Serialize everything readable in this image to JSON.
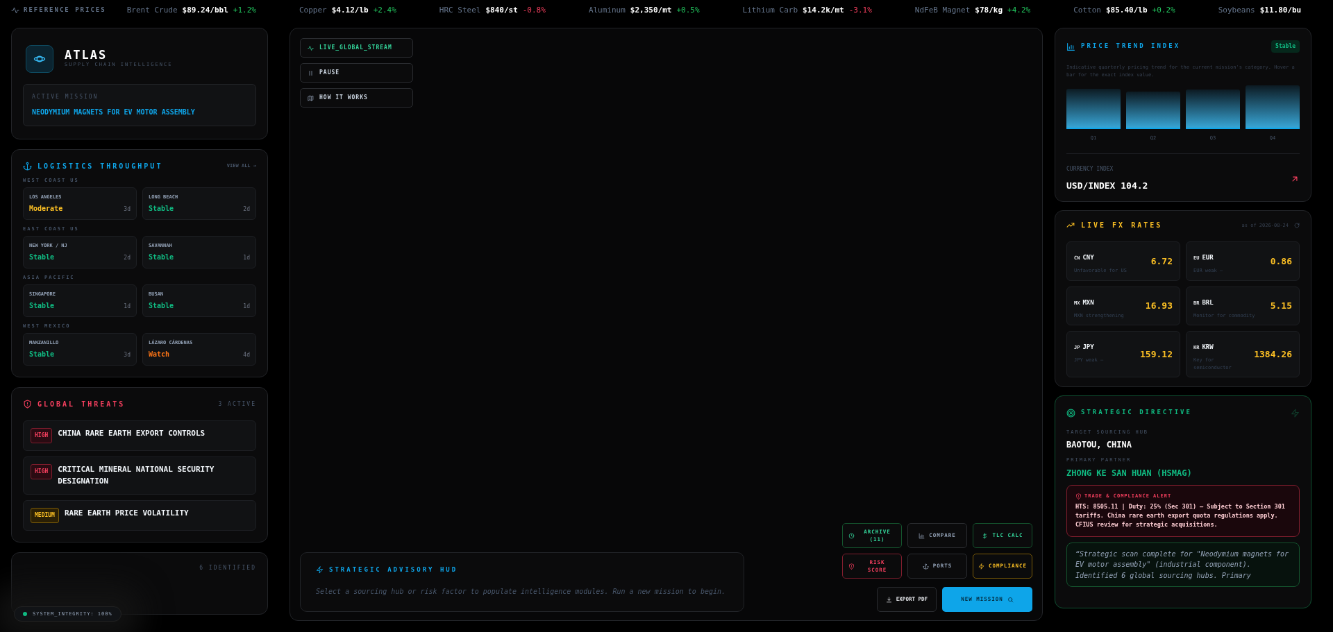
{
  "ticker": {
    "label": "REFERENCE PRICES",
    "items": [
      {
        "name": "Brent Crude",
        "price": "$89.24/bbl",
        "change": "+1.2%"
      },
      {
        "name": "Copper",
        "price": "$4.12/lb",
        "change": "+2.4%"
      },
      {
        "name": "HRC Steel",
        "price": "$840/st",
        "change": "-0.8%"
      },
      {
        "name": "Aluminum",
        "price": "$2,350/mt",
        "change": "+0.5%"
      },
      {
        "name": "Lithium Carb",
        "price": "$14.2k/mt",
        "change": "-3.1%"
      },
      {
        "name": "NdFeB Magnet",
        "price": "$78/kg",
        "change": "+4.2%"
      },
      {
        "name": "Cotton",
        "price": "$85.40/lb",
        "change": "+0.2%"
      },
      {
        "name": "Soybeans",
        "price": "$11.80/bu"
      }
    ]
  },
  "brand": {
    "title": "ATLAS",
    "subtitle": "SUPPLY CHAIN INTELLIGENCE"
  },
  "mission": {
    "label": "ACTIVE MISSION",
    "value": "NEODYMIUM MAGNETS FOR EV MOTOR ASSEMBLY"
  },
  "logistics": {
    "title": "LOGISTICS THROUGHPUT",
    "link": "VIEW ALL →",
    "regions": [
      {
        "name": "WEST COAST US",
        "ports": [
          {
            "name": "LOS ANGELES",
            "status": "Moderate",
            "kind": "moderate",
            "age": "3d"
          },
          {
            "name": "LONG BEACH",
            "status": "Stable",
            "kind": "stable",
            "age": "2d"
          }
        ]
      },
      {
        "name": "EAST COAST US",
        "ports": [
          {
            "name": "NEW YORK / NJ",
            "status": "Stable",
            "kind": "stable",
            "age": "2d"
          },
          {
            "name": "SAVANNAH",
            "status": "Stable",
            "kind": "stable",
            "age": "1d"
          }
        ]
      },
      {
        "name": "ASIA PACIFIC",
        "ports": [
          {
            "name": "SINGAPORE",
            "status": "Stable",
            "kind": "stable",
            "age": "1d"
          },
          {
            "name": "BUSAN",
            "status": "Stable",
            "kind": "stable",
            "age": "1d"
          }
        ]
      },
      {
        "name": "WEST MEXICO",
        "ports": [
          {
            "name": "MANZANILLO",
            "status": "Stable",
            "kind": "stable",
            "age": "3d"
          },
          {
            "name": "LÁZARO CÁRDENAS",
            "status": "Watch",
            "kind": "watch",
            "age": "4d"
          }
        ]
      }
    ]
  },
  "threats": {
    "title": "GLOBAL THREATS",
    "count": "3 ACTIVE",
    "items": [
      {
        "severity": "HIGH",
        "kind": "high",
        "title": "CHINA RARE EARTH EXPORT CONTROLS"
      },
      {
        "severity": "HIGH",
        "kind": "high",
        "title": "CRITICAL MINERAL NATIONAL SECURITY DESIGNATION"
      },
      {
        "severity": "MEDIUM",
        "kind": "medium",
        "title": "RARE EARTH PRICE VOLATILITY"
      }
    ]
  },
  "hubs": {
    "count": "6 IDENTIFIED"
  },
  "system": {
    "label": "SYSTEM_INTEGRITY: 100%"
  },
  "center": {
    "controls": [
      {
        "label": "LIVE_GLOBAL_STREAM",
        "kind": "live"
      },
      {
        "label": "PAUSE",
        "kind": "pause"
      },
      {
        "label": "HOW IT WORKS",
        "kind": "help"
      }
    ],
    "hud": {
      "title": "STRATEGIC ADVISORY HUD",
      "text": "Select a sourcing hub or risk factor to populate intelligence modules. Run a new mission to begin."
    },
    "actions": [
      {
        "label": "ARCHIVE (11)",
        "kind": "archive"
      },
      {
        "label": "COMPARE",
        "kind": "compare"
      },
      {
        "label": "TLC CALC",
        "kind": "calc"
      },
      {
        "label": "RISK SCORE",
        "kind": "risk"
      },
      {
        "label": "PORTS",
        "kind": "ports"
      },
      {
        "label": "COMPLIANCE",
        "kind": "compliance"
      }
    ],
    "export": "EXPORT PDF",
    "new_mission": "NEW MISSION"
  },
  "price_trend": {
    "title": "PRICE TREND INDEX",
    "badge": "Stable",
    "description": "Indicative quarterly pricing trend for the current mission's category. Hover a bar for the exact index value.",
    "bars": [
      {
        "label": "Q1"
      },
      {
        "label": "Q2"
      },
      {
        "label": "Q3"
      },
      {
        "label": "Q4"
      }
    ],
    "currency_label": "CURRENCY INDEX",
    "currency_value": "USD/INDEX 104.2"
  },
  "fx": {
    "title": "LIVE FX RATES",
    "as_of": "as of 2026-08-24",
    "rates": [
      {
        "flag": "CN",
        "code": "CNY",
        "note": "Unfavorable for US",
        "rate": "6.72"
      },
      {
        "flag": "EU",
        "code": "EUR",
        "note": "EUR weak —",
        "rate": "0.86"
      },
      {
        "flag": "MX",
        "code": "MXN",
        "note": "MXN strengthening",
        "rate": "16.93"
      },
      {
        "flag": "BR",
        "code": "BRL",
        "note": "Monitor for commodity",
        "rate": "5.15"
      },
      {
        "flag": "JP",
        "code": "JPY",
        "note": "JPY weak —",
        "rate": "159.12"
      },
      {
        "flag": "KR",
        "code": "KRW",
        "note": "Key for semiconductor",
        "rate": "1384.26"
      }
    ]
  },
  "directive": {
    "title": "STRATEGIC DIRECTIVE",
    "hub_label": "TARGET SOURCING HUB",
    "hub": "BAOTOU, CHINA",
    "partner_label": "PRIMARY PARTNER",
    "partner": "ZHONG KE SAN HUAN (HSMAG)",
    "alert": {
      "title": "TRADE & COMPLIANCE ALERT",
      "text": "HTS: 8505.11 | Duty: 25% (Sec 301) — Subject to Section 301 tariffs. China rare earth export quota regulations apply. CFIUS review for strategic acquisitions."
    },
    "quote": "“Strategic scan complete for \"Neodymium magnets for EV motor assembly\" (industrial component). Identified 6 global sourcing hubs. Primary"
  }
}
